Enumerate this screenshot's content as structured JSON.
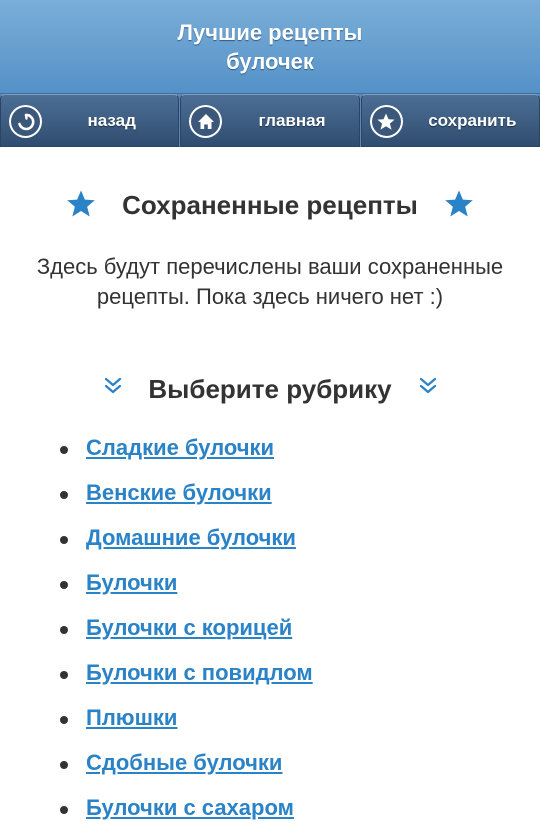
{
  "header": {
    "title": "Лучшие рецепты булочек"
  },
  "nav": {
    "back_label": "назад",
    "home_label": "главная",
    "save_label": "сохранить"
  },
  "saved": {
    "heading": "Сохраненные рецепты",
    "info": "Здесь будут перечислены ваши сохраненные рецепты. Пока здесь ничего нет :)"
  },
  "rubric": {
    "heading": "Выберите рубрику",
    "categories": [
      "Сладкие булочки",
      "Венские булочки",
      "Домашние булочки",
      "Булочки",
      "Булочки с корицей",
      "Булочки с повидлом",
      "Плюшки",
      "Сдобные булочки",
      "Булочки с сахаром"
    ]
  },
  "colors": {
    "header_top": "#7aaed8",
    "header_bottom": "#5591c8",
    "nav_button": "#3b587a",
    "accent_star": "#2a82c7",
    "link": "#2a82c7",
    "text": "#333333"
  }
}
